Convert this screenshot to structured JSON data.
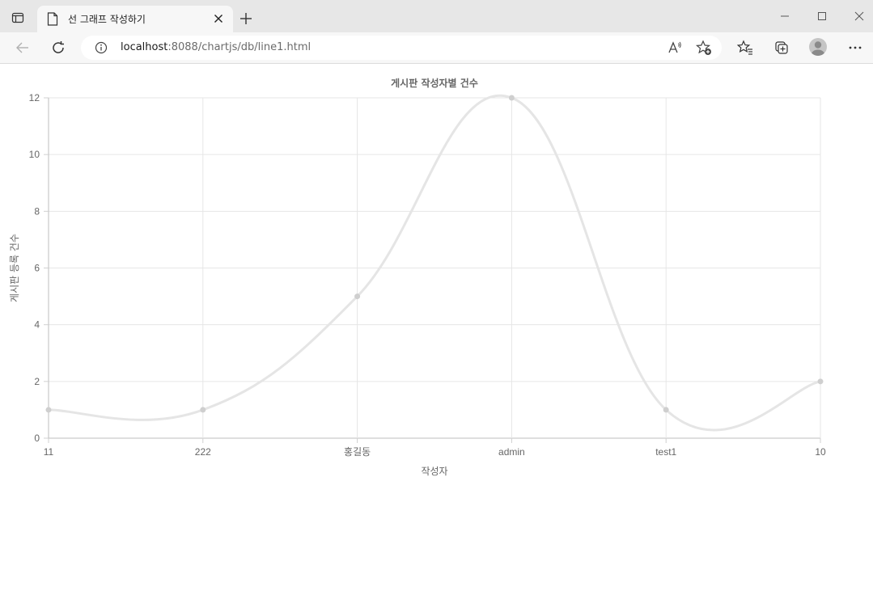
{
  "browser": {
    "tab": {
      "title": "선 그래프 작성하기",
      "favicon_icon": "page-icon"
    },
    "address": {
      "host": "localhost",
      "path": ":8088/chartjs/db/line1.html"
    },
    "icons": {
      "tab_actions": "tab-actions-icon",
      "close_tab": "close-icon",
      "new_tab": "plus-icon",
      "minimize": "minimize-icon",
      "maximize": "maximize-icon",
      "close_window": "close-window-icon",
      "back": "back-arrow-icon",
      "refresh": "refresh-icon",
      "info": "info-icon",
      "read_aloud": "read-aloud-icon",
      "add_favorite": "add-favorite-icon",
      "favorites": "favorites-icon",
      "collections": "collections-icon",
      "profile": "profile-avatar",
      "more": "more-icon"
    }
  },
  "chart_data": {
    "type": "line",
    "title": "게시판 작성자별 건수",
    "xlabel": "작성자",
    "ylabel": "게시판 등록 건수",
    "categories": [
      "11",
      "222",
      "홍길동",
      "admin",
      "test1",
      "10"
    ],
    "series": [
      {
        "values": [
          1,
          1,
          5,
          12,
          1,
          2
        ]
      }
    ],
    "ylim": [
      0,
      12
    ],
    "yticks": [
      0,
      2,
      4,
      6,
      8,
      10,
      12
    ],
    "grid": true,
    "smooth": true,
    "line_color": "#e5e5e5",
    "point_color": "#cfcfcf"
  }
}
